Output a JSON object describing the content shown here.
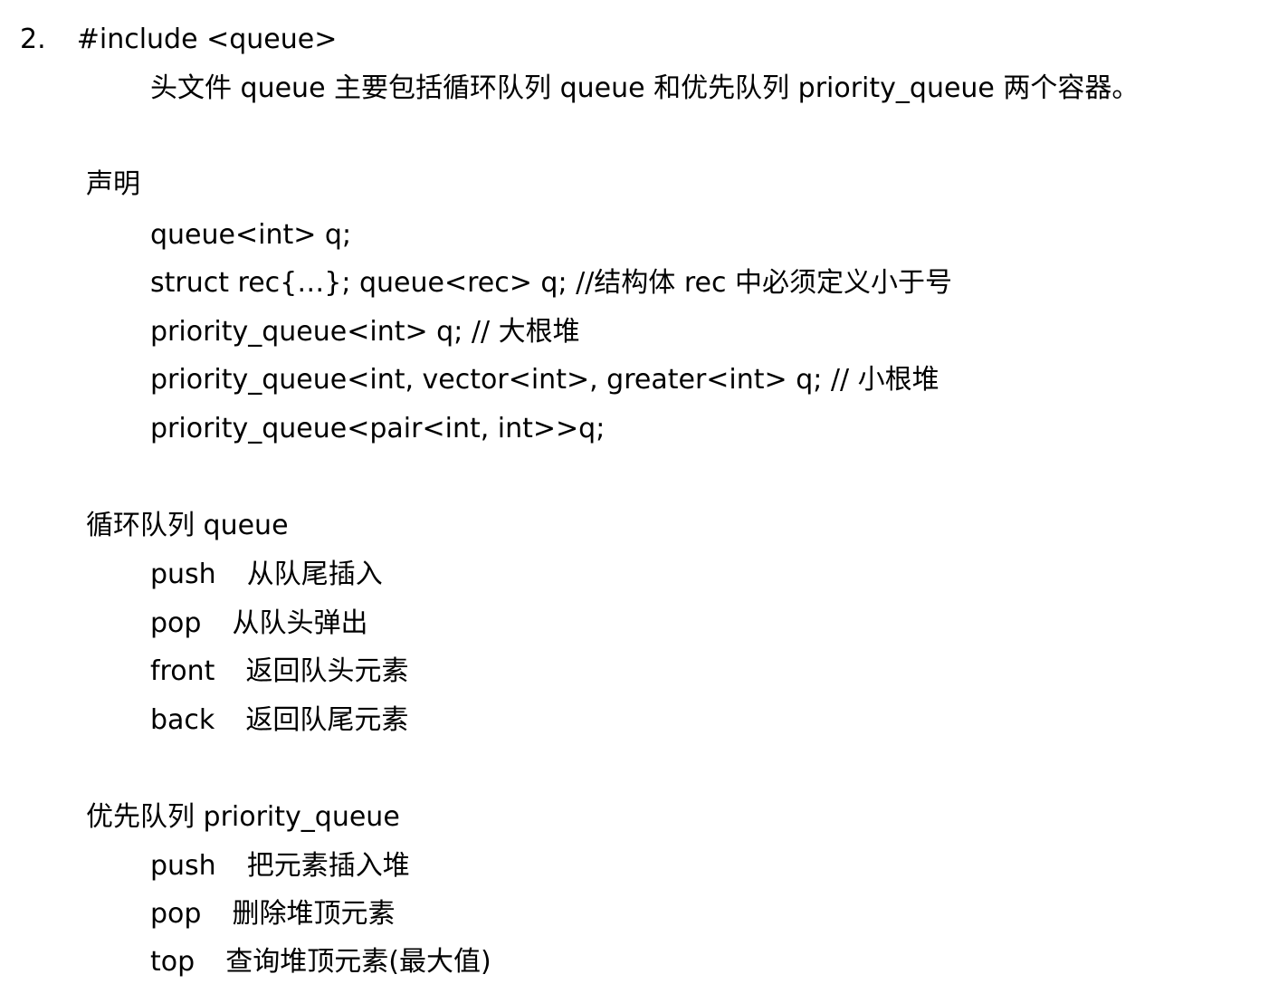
{
  "heading": {
    "number": "2.",
    "title": "#include <queue>"
  },
  "intro": "头文件 queue 主要包括循环队列 queue 和优先队列 priority_queue 两个容器。",
  "declaration": {
    "title": "声明",
    "lines": [
      "queue<int> q;",
      "struct rec{…}; queue<rec> q;  //结构体 rec 中必须定义小于号",
      "priority_queue<int> q;     // 大根堆",
      "priority_queue<int, vector<int>, greater<int> q;  // 小根堆",
      "priority_queue<pair<int, int>>q;"
    ]
  },
  "circular_queue": {
    "title": "循环队列 queue",
    "ops": [
      {
        "name": "push",
        "desc": "从队尾插入"
      },
      {
        "name": "pop",
        "desc": "从队头弹出"
      },
      {
        "name": "front",
        "desc": "返回队头元素"
      },
      {
        "name": "back",
        "desc": "返回队尾元素"
      }
    ]
  },
  "priority_queue": {
    "title": "优先队列 priority_queue",
    "ops": [
      {
        "name": "push",
        "desc": "把元素插入堆"
      },
      {
        "name": "pop",
        "desc": "删除堆顶元素"
      },
      {
        "name": "top",
        "desc": "查询堆顶元素(最大值)"
      }
    ]
  }
}
